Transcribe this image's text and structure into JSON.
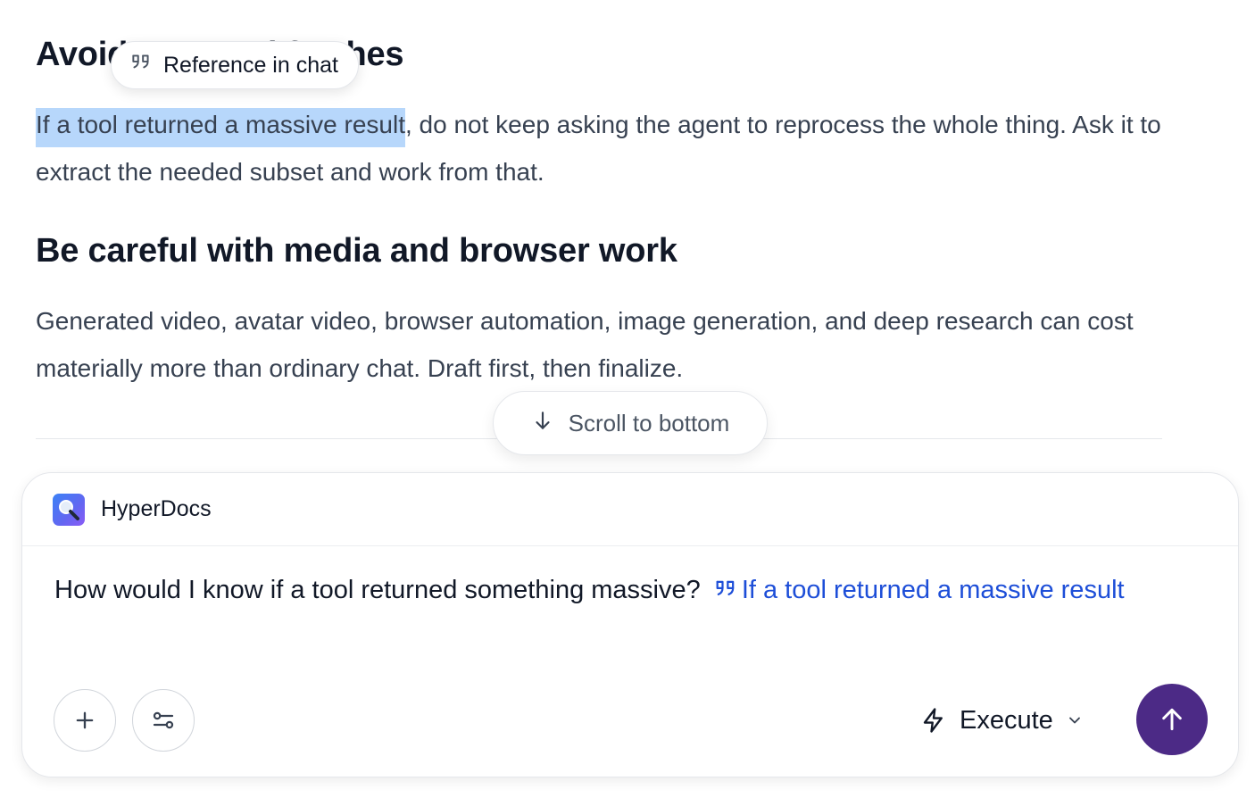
{
  "document": {
    "heading1": "Avoid repeated fetches",
    "para1_highlight": "If a tool returned a massive result",
    "para1_rest": ", do not keep asking the agent to reprocess the whole thing. Ask it to extract the needed subset and work from that.",
    "heading2": "Be careful with media and browser work",
    "para2": "Generated video, avatar video, browser automation, image generation, and deep research can cost materially more than ordinary chat. Draft first, then finalize."
  },
  "selection_popover": {
    "label": "Reference in chat",
    "icon": "quote-icon"
  },
  "scroll_button": {
    "label": "Scroll to bottom",
    "icon": "arrow-down-icon"
  },
  "composer": {
    "app_name": "HyperDocs",
    "message_text": "How would I know if a tool returned something massive?",
    "reference_chip": "If a tool returned a massive result",
    "mode_label": "Execute",
    "mode_icon": "lightning-icon",
    "add_icon": "plus-icon",
    "settings_icon": "sliders-icon",
    "send_icon": "arrow-up-icon"
  },
  "colors": {
    "highlight": "#b7d7fb",
    "reference_link": "#1d4ed8",
    "send_button": "#4c2a86"
  }
}
